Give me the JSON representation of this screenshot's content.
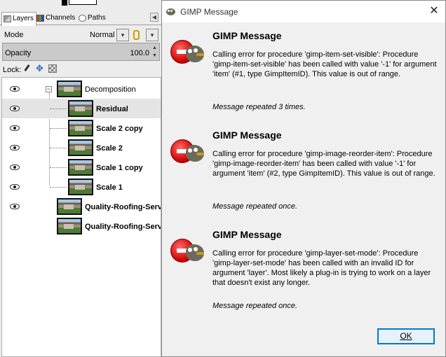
{
  "layers_panel": {
    "tabs": [
      {
        "label": "Layers",
        "icon": "layers-icon",
        "active": true
      },
      {
        "label": "Channels",
        "icon": "channels-icon",
        "active": false
      },
      {
        "label": "Paths",
        "icon": "paths-icon",
        "active": false
      }
    ],
    "mode": {
      "label": "Mode",
      "value": "Normal"
    },
    "opacity": {
      "label": "Opacity",
      "value": "100.0"
    },
    "lock": {
      "label": "Lock:"
    },
    "layers": [
      {
        "name": "Decomposition",
        "type": "group",
        "expanded": true,
        "visible": true
      },
      {
        "name": "Residual",
        "type": "layer",
        "visible": true,
        "selected": true
      },
      {
        "name": "Scale 2 copy",
        "type": "layer",
        "visible": true
      },
      {
        "name": "Scale 2",
        "type": "layer",
        "visible": true
      },
      {
        "name": "Scale 1 copy",
        "type": "layer",
        "visible": true
      },
      {
        "name": "Scale 1",
        "type": "layer",
        "visible": true
      },
      {
        "name": "Quality-Roofing-Servic",
        "type": "layer",
        "visible": true
      },
      {
        "name": "Quality-Roofing-Servic",
        "type": "layer",
        "visible": false
      }
    ]
  },
  "dialog": {
    "title": "GIMP Message",
    "close_glyph": "✕",
    "messages": [
      {
        "heading": "GIMP Message",
        "body": "Calling error for procedure 'gimp-item-set-visible': Procedure 'gimp-item-set-visible' has been called with value '-1' for argument 'item' (#1, type GimpItemID). This value is out of range.",
        "repeat": "Message repeated 3 times."
      },
      {
        "heading": "GIMP Message",
        "body": "Calling error for procedure 'gimp-image-reorder-item': Procedure 'gimp-image-reorder-item' has been called with value '-1' for argument 'item' (#2, type GimpItemID). This value is out of range.",
        "repeat": "Message repeated once."
      },
      {
        "heading": "GIMP Message",
        "body": "Calling error for procedure 'gimp-layer-set-mode': Procedure 'gimp-layer-set-mode' has been called with an invalid ID for argument 'layer'. Most likely a plug-in is trying to work on a layer that doesn't exist any longer.",
        "repeat": "Message repeated once."
      }
    ],
    "ok_label": "OK"
  },
  "colors": {
    "error_red": "#d10000",
    "button_border": "#0078d7",
    "selected_row": "#e4e4e4"
  }
}
